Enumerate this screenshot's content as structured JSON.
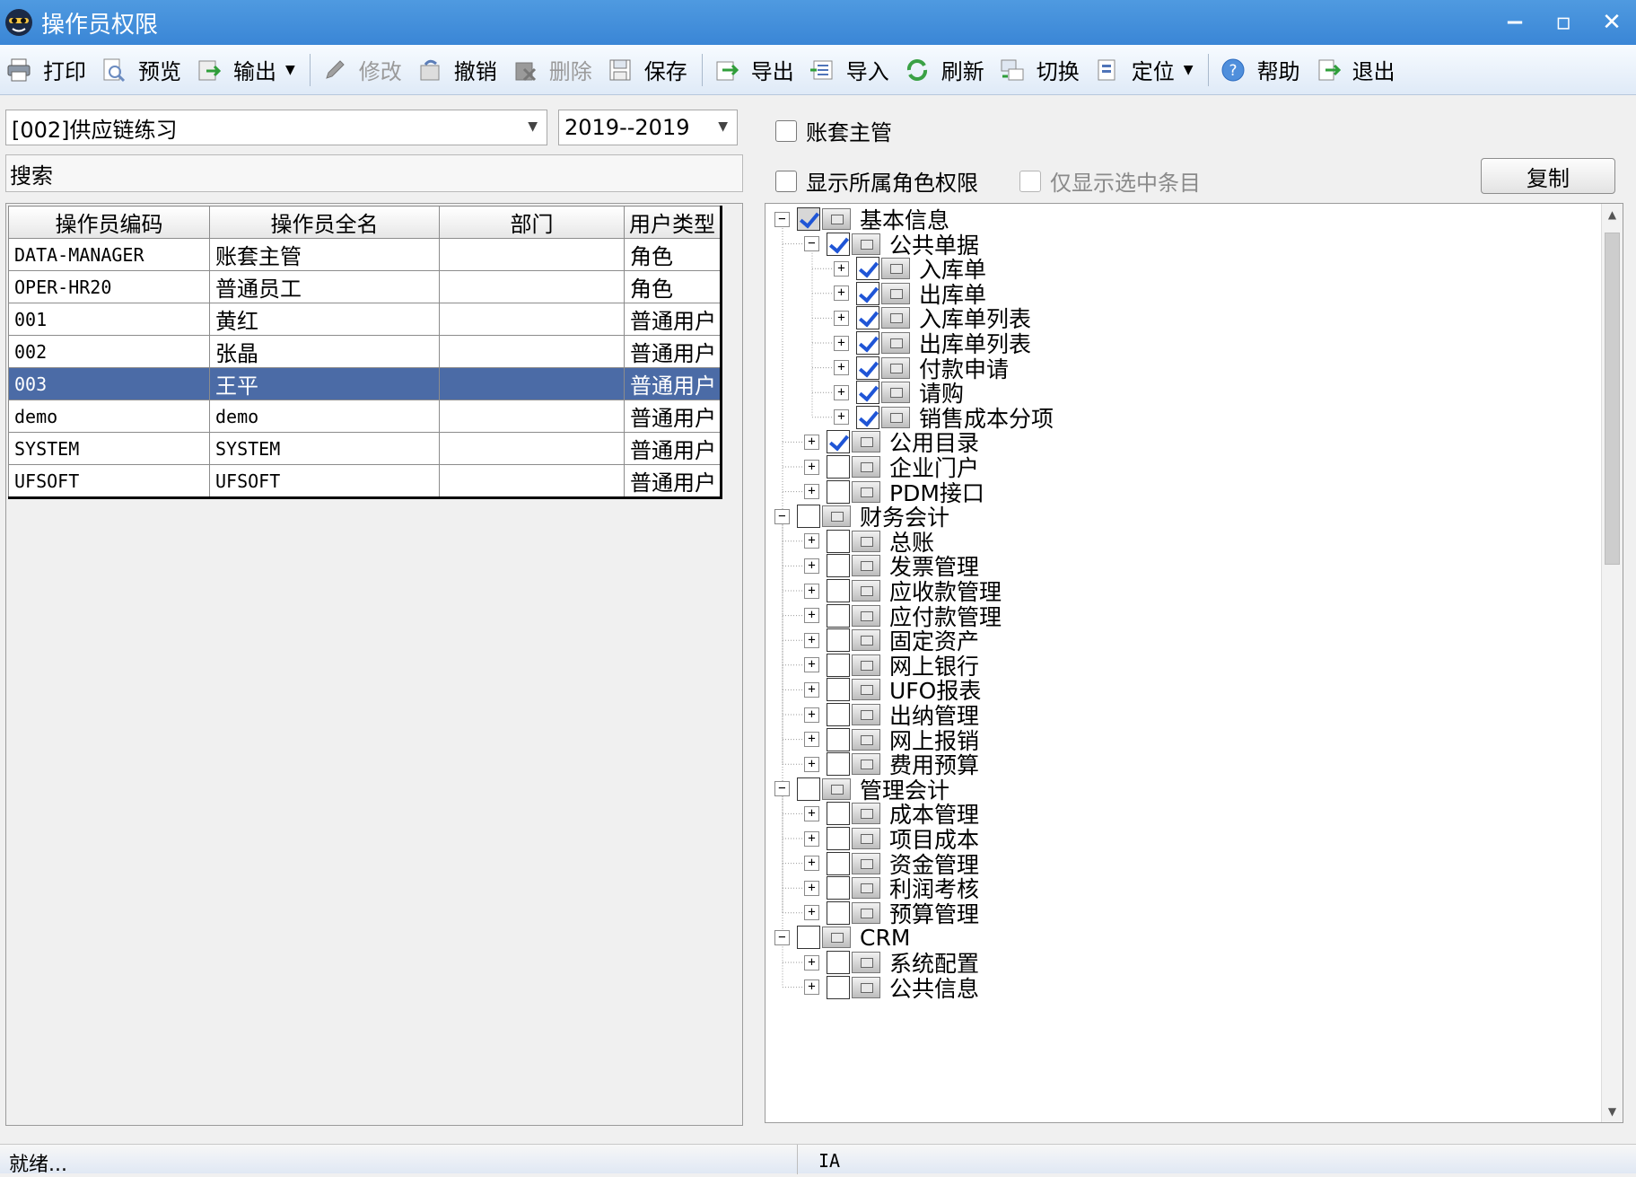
{
  "window": {
    "title": "操作员权限",
    "minimize": "−",
    "maximize": "▫",
    "close": "✕"
  },
  "toolbar": {
    "items": [
      {
        "label": "打印",
        "icon": "printer-icon",
        "enabled": true,
        "dropdown": false
      },
      {
        "label": "预览",
        "icon": "preview-icon",
        "enabled": true,
        "dropdown": false
      },
      {
        "label": "输出",
        "icon": "export-output-icon",
        "enabled": true,
        "dropdown": true
      },
      {
        "label": "修改",
        "icon": "pencil-icon",
        "enabled": false,
        "dropdown": false
      },
      {
        "label": "撤销",
        "icon": "undo-icon",
        "enabled": true,
        "dropdown": false
      },
      {
        "label": "删除",
        "icon": "delete-icon",
        "enabled": false,
        "dropdown": false
      },
      {
        "label": "保存",
        "icon": "save-icon",
        "enabled": true,
        "dropdown": false
      },
      {
        "label": "导出",
        "icon": "export-icon",
        "enabled": true,
        "dropdown": false
      },
      {
        "label": "导入",
        "icon": "import-icon",
        "enabled": true,
        "dropdown": false
      },
      {
        "label": "刷新",
        "icon": "refresh-icon",
        "enabled": true,
        "dropdown": false
      },
      {
        "label": "切换",
        "icon": "switch-icon",
        "enabled": true,
        "dropdown": false
      },
      {
        "label": "定位",
        "icon": "locate-icon",
        "enabled": true,
        "dropdown": true
      },
      {
        "label": "帮助",
        "icon": "help-icon",
        "enabled": true,
        "dropdown": false
      },
      {
        "label": "退出",
        "icon": "exit-icon",
        "enabled": true,
        "dropdown": false
      }
    ]
  },
  "left": {
    "account_select": "[002]供应链练习",
    "year_select": "2019--2019",
    "search_label": "搜索",
    "table": {
      "headers": [
        "操作员编码",
        "操作员全名",
        "部门",
        "用户类型"
      ],
      "rows": [
        {
          "code": "DATA-MANAGER",
          "name": "账套主管",
          "dept": "",
          "type": "角色",
          "selected": false
        },
        {
          "code": "OPER-HR20",
          "name": "普通员工",
          "dept": "",
          "type": "角色",
          "selected": false
        },
        {
          "code": "001",
          "name": "黄红",
          "dept": "",
          "type": "普通用户",
          "selected": false
        },
        {
          "code": "002",
          "name": "张晶",
          "dept": "",
          "type": "普通用户",
          "selected": false
        },
        {
          "code": "003",
          "name": "王平",
          "dept": "",
          "type": "普通用户",
          "selected": true
        },
        {
          "code": "demo",
          "name": "demo",
          "dept": "",
          "type": "普通用户",
          "selected": false
        },
        {
          "code": "SYSTEM",
          "name": "SYSTEM",
          "dept": "",
          "type": "普通用户",
          "selected": false
        },
        {
          "code": "UFSOFT",
          "name": "UFSOFT",
          "dept": "",
          "type": "普通用户",
          "selected": false
        }
      ]
    }
  },
  "right": {
    "account_manager_label": "账套主管",
    "show_role_perm_label": "显示所属角色权限",
    "only_selected_label": "仅显示选中条目",
    "copy_button": "复制",
    "tree": [
      {
        "level": 0,
        "expanded": true,
        "checked": true,
        "label": "基本信息"
      },
      {
        "level": 1,
        "expanded": true,
        "checked": true,
        "label": "公共单据"
      },
      {
        "level": 2,
        "expanded": false,
        "checked": true,
        "label": "入库单"
      },
      {
        "level": 2,
        "expanded": false,
        "checked": true,
        "label": "出库单"
      },
      {
        "level": 2,
        "expanded": false,
        "checked": true,
        "label": "入库单列表"
      },
      {
        "level": 2,
        "expanded": false,
        "checked": true,
        "label": "出库单列表"
      },
      {
        "level": 2,
        "expanded": false,
        "checked": true,
        "label": "付款申请"
      },
      {
        "level": 2,
        "expanded": false,
        "checked": true,
        "label": "请购"
      },
      {
        "level": 2,
        "expanded": false,
        "checked": true,
        "label": "销售成本分项"
      },
      {
        "level": 1,
        "expanded": false,
        "checked": true,
        "label": "公用目录"
      },
      {
        "level": 1,
        "expanded": false,
        "checked": false,
        "label": "企业门户"
      },
      {
        "level": 1,
        "expanded": false,
        "checked": false,
        "label": "PDM接口"
      },
      {
        "level": 0,
        "expanded": true,
        "checked": false,
        "label": "财务会计"
      },
      {
        "level": 1,
        "expanded": false,
        "checked": false,
        "label": "总账"
      },
      {
        "level": 1,
        "expanded": false,
        "checked": false,
        "label": "发票管理"
      },
      {
        "level": 1,
        "expanded": false,
        "checked": false,
        "label": "应收款管理"
      },
      {
        "level": 1,
        "expanded": false,
        "checked": false,
        "label": "应付款管理"
      },
      {
        "level": 1,
        "expanded": false,
        "checked": false,
        "label": "固定资产"
      },
      {
        "level": 1,
        "expanded": false,
        "checked": false,
        "label": "网上银行"
      },
      {
        "level": 1,
        "expanded": false,
        "checked": false,
        "label": "UFO报表"
      },
      {
        "level": 1,
        "expanded": false,
        "checked": false,
        "label": "出纳管理"
      },
      {
        "level": 1,
        "expanded": false,
        "checked": false,
        "label": "网上报销"
      },
      {
        "level": 1,
        "expanded": false,
        "checked": false,
        "label": "费用预算"
      },
      {
        "level": 0,
        "expanded": true,
        "checked": false,
        "label": "管理会计"
      },
      {
        "level": 1,
        "expanded": false,
        "checked": false,
        "label": "成本管理"
      },
      {
        "level": 1,
        "expanded": false,
        "checked": false,
        "label": "项目成本"
      },
      {
        "level": 1,
        "expanded": false,
        "checked": false,
        "label": "资金管理"
      },
      {
        "level": 1,
        "expanded": false,
        "checked": false,
        "label": "利润考核"
      },
      {
        "level": 1,
        "expanded": false,
        "checked": false,
        "label": "预算管理"
      },
      {
        "level": 0,
        "expanded": true,
        "checked": false,
        "label": "CRM"
      },
      {
        "level": 1,
        "expanded": false,
        "checked": false,
        "label": "系统配置"
      },
      {
        "level": 1,
        "expanded": false,
        "checked": false,
        "label": "公共信息"
      }
    ]
  },
  "status": {
    "left": "就绪...",
    "right": "IA"
  },
  "colors": {
    "title_bar": "#3a86d6",
    "selected_row": "#4b6ba6",
    "check_mark": "#1f55d6"
  }
}
